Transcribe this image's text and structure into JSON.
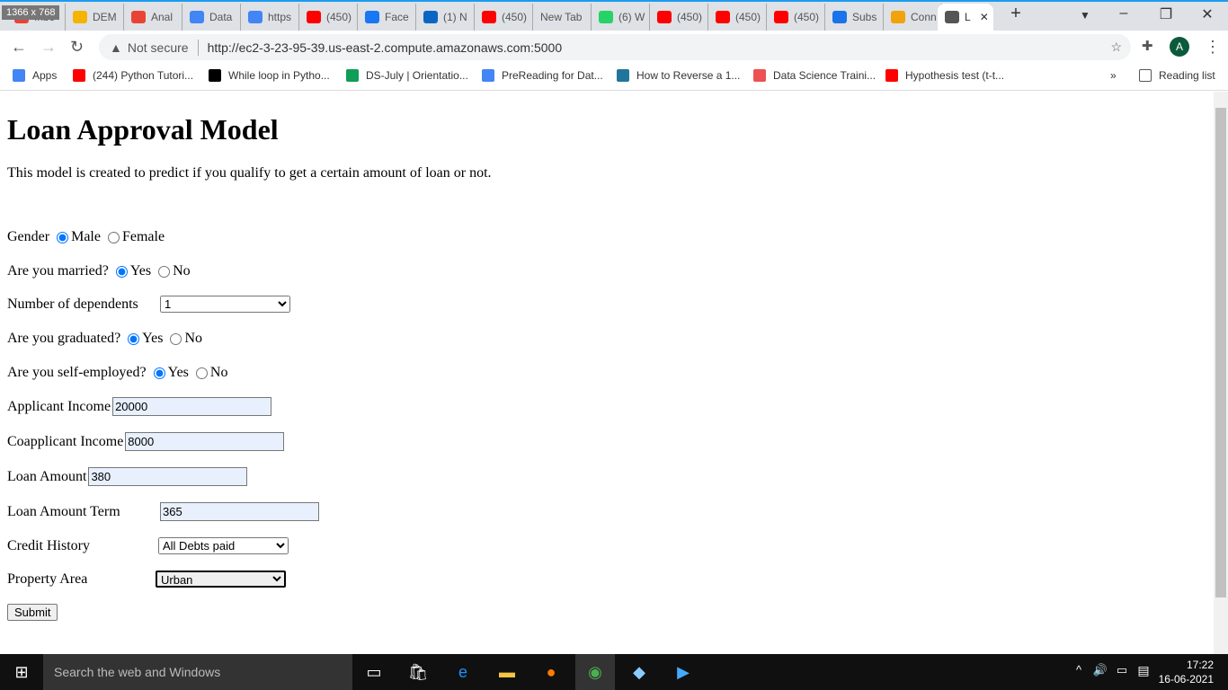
{
  "overlay": "1366 x 768",
  "tabs": [
    {
      "label": "Inbc",
      "color": "#ea4335"
    },
    {
      "label": "DEM",
      "color": "#f4b400"
    },
    {
      "label": "Anal",
      "color": "#ea4335"
    },
    {
      "label": "Data",
      "color": "#4285f4"
    },
    {
      "label": "https",
      "color": "#4285f4"
    },
    {
      "label": "(450)",
      "color": "#ff0000"
    },
    {
      "label": "Face",
      "color": "#1877f2"
    },
    {
      "label": "(1) N",
      "color": "#0a66c2"
    },
    {
      "label": "(450)",
      "color": "#ff0000"
    },
    {
      "label": "New Tab",
      "color": ""
    },
    {
      "label": "(6) W",
      "color": "#25d366"
    },
    {
      "label": "(450)",
      "color": "#ff0000"
    },
    {
      "label": "(450)",
      "color": "#ff0000"
    },
    {
      "label": "(450)",
      "color": "#ff0000"
    },
    {
      "label": "Subs",
      "color": "#1a73e8"
    },
    {
      "label": "Conn",
      "color": "#f0a30a"
    },
    {
      "label": "L",
      "color": "#555"
    }
  ],
  "omnibox": {
    "security": "Not secure",
    "url": "http://ec2-3-23-95-39.us-east-2.compute.amazonaws.com:5000"
  },
  "profile_initial": "A",
  "bookmarks": [
    {
      "label": "Apps",
      "color": "#4285f4"
    },
    {
      "label": "(244) Python Tutori...",
      "color": "#ff0000"
    },
    {
      "label": "While loop in Pytho...",
      "color": "#000"
    },
    {
      "label": "DS-July | Orientatio...",
      "color": "#0f9d58"
    },
    {
      "label": "PreReading for Dat...",
      "color": "#4285f4"
    },
    {
      "label": "How to Reverse a 1...",
      "color": "#21759b"
    },
    {
      "label": "Data Science Traini...",
      "color": "#ec5252"
    },
    {
      "label": "Hypothesis test (t-t...",
      "color": "#ff0000"
    }
  ],
  "reading_list": "Reading list",
  "page": {
    "title": "Loan Approval Model",
    "description": "This model is created to predict if you qualify to get a certain amount of loan or not.",
    "gender": {
      "label": "Gender",
      "options": [
        "Male",
        "Female"
      ],
      "selected": "Male"
    },
    "married": {
      "label": "Are you married?",
      "options": [
        "Yes",
        "No"
      ],
      "selected": "Yes"
    },
    "dependents": {
      "label": "Number of dependents",
      "value": "1"
    },
    "graduated": {
      "label": "Are you graduated?",
      "options": [
        "Yes",
        "No"
      ],
      "selected": "Yes"
    },
    "self_employed": {
      "label": "Are you self-employed?",
      "options": [
        "Yes",
        "No"
      ],
      "selected": "Yes"
    },
    "applicant_income": {
      "label": "Applicant Income",
      "value": "20000"
    },
    "coapplicant_income": {
      "label": "Coapplicant Income",
      "value": "8000"
    },
    "loan_amount": {
      "label": "Loan Amount",
      "value": "380"
    },
    "loan_term": {
      "label": "Loan Amount Term",
      "value": "365"
    },
    "credit_history": {
      "label": "Credit History",
      "value": "All Debts paid"
    },
    "property_area": {
      "label": "Property Area",
      "value": "Urban"
    },
    "submit": "Submit"
  },
  "taskbar": {
    "search_placeholder": "Search the web and Windows",
    "time": "17:22",
    "date": "16-06-2021"
  }
}
